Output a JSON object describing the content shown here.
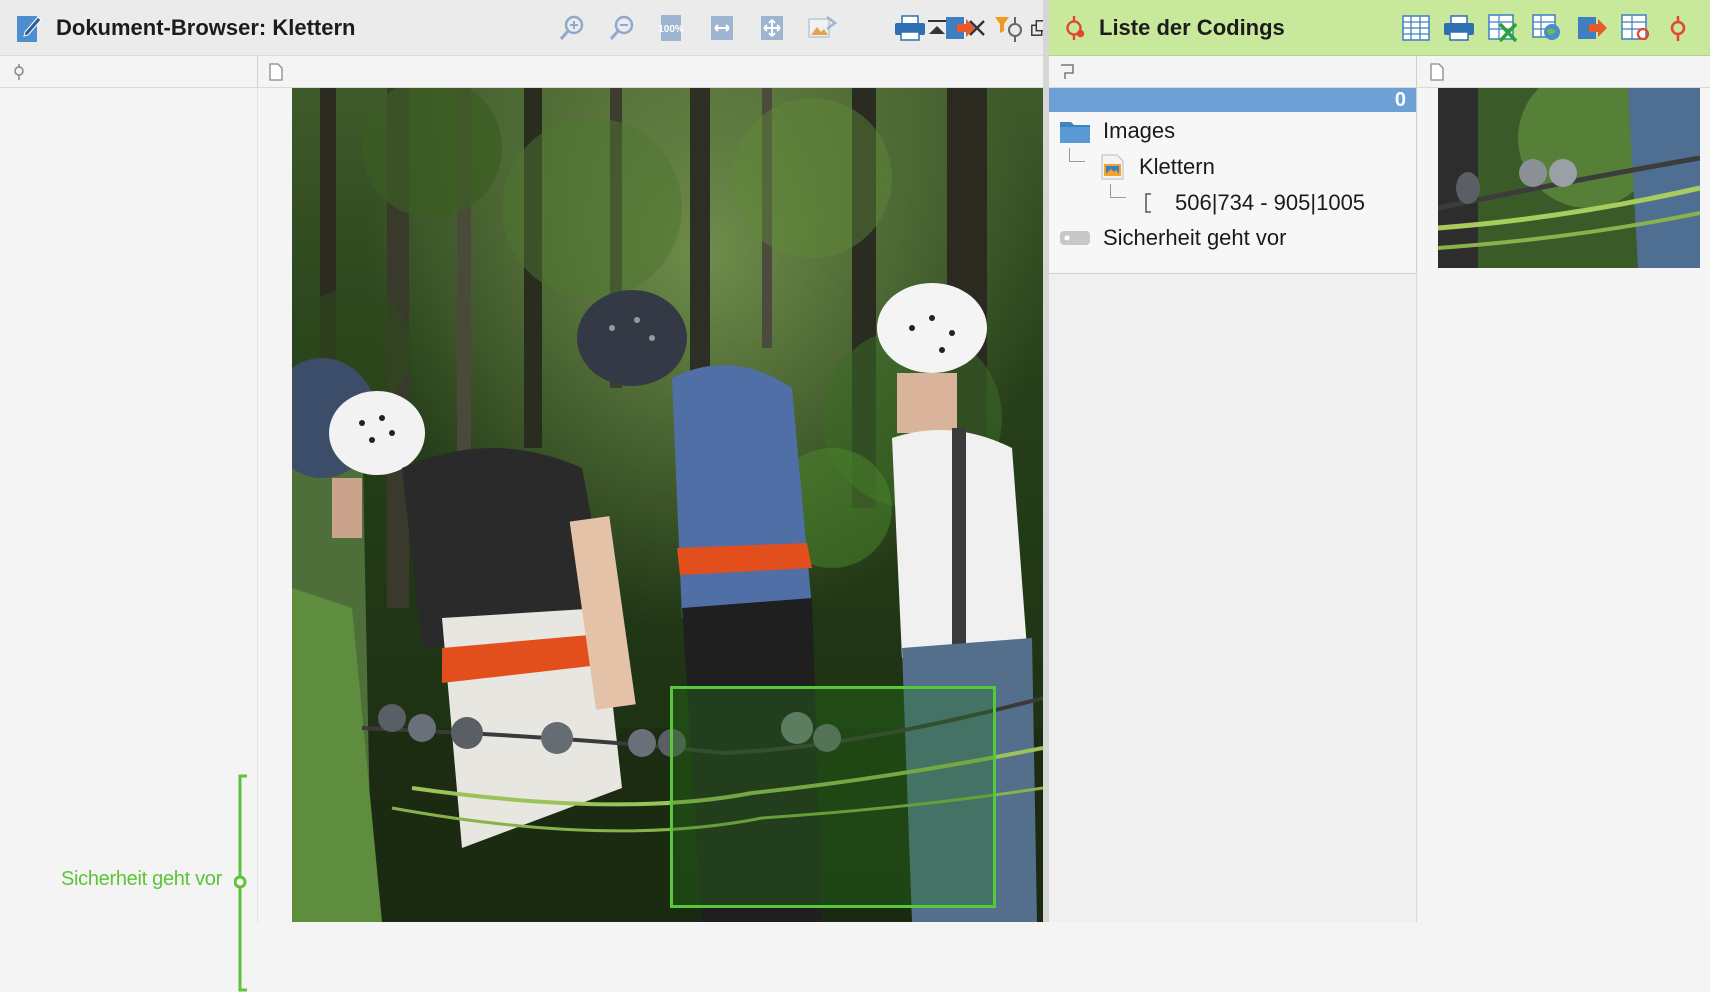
{
  "doc_browser": {
    "title": "Dokument-Browser: Klettern",
    "toolbar": [
      {
        "name": "zoom-in-icon"
      },
      {
        "name": "zoom-out-icon"
      },
      {
        "name": "zoom-100-icon",
        "label": "100%"
      },
      {
        "name": "fit-width-icon"
      },
      {
        "name": "pan-icon"
      },
      {
        "name": "image-export-icon"
      },
      {
        "name": "print-icon"
      },
      {
        "name": "export-icon"
      },
      {
        "name": "filter-codings-icon"
      },
      {
        "name": "undock-icon"
      },
      {
        "name": "collapse-icon"
      },
      {
        "name": "close-icon"
      }
    ],
    "margin_coding_label": "Sicherheit geht vor",
    "coding_color": "#5ec437"
  },
  "codings": {
    "title": "Liste der Codings",
    "toolbar": [
      {
        "name": "table-view-icon"
      },
      {
        "name": "print-icon"
      },
      {
        "name": "excel-export-icon"
      },
      {
        "name": "web-export-icon"
      },
      {
        "name": "export-icon"
      },
      {
        "name": "coding-table-icon"
      },
      {
        "name": "code-icon"
      }
    ],
    "selected_count": "0",
    "tree": {
      "folder": "Images",
      "document": "Klettern",
      "segment": "506|734 - 905|1005",
      "code": "Sicherheit geht vor"
    },
    "title_bar_color": "#c8e89c",
    "selection_color": "#6da1d5"
  }
}
